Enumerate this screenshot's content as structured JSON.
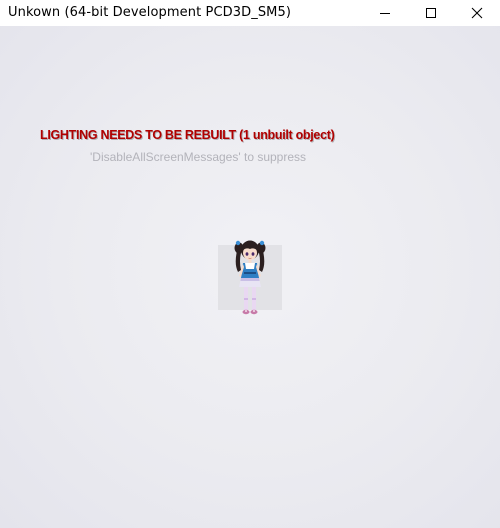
{
  "window": {
    "title": "Unkown (64-bit Development PCD3D_SM5)",
    "controls": {
      "minimize_icon": "minimize-icon",
      "maximize_icon": "maximize-icon",
      "close_icon": "close-icon"
    }
  },
  "viewport": {
    "messages": {
      "warning": "LIGHTING NEEDS TO BE REBUILT (1 unbuilt object)",
      "hint": "'DisableAllScreenMessages' to suppress"
    },
    "colors": {
      "warning": "#b00000",
      "hint": "#b3b3ba",
      "background": "#ebebf0"
    },
    "character": {
      "icon": "anime-girl-character"
    }
  }
}
